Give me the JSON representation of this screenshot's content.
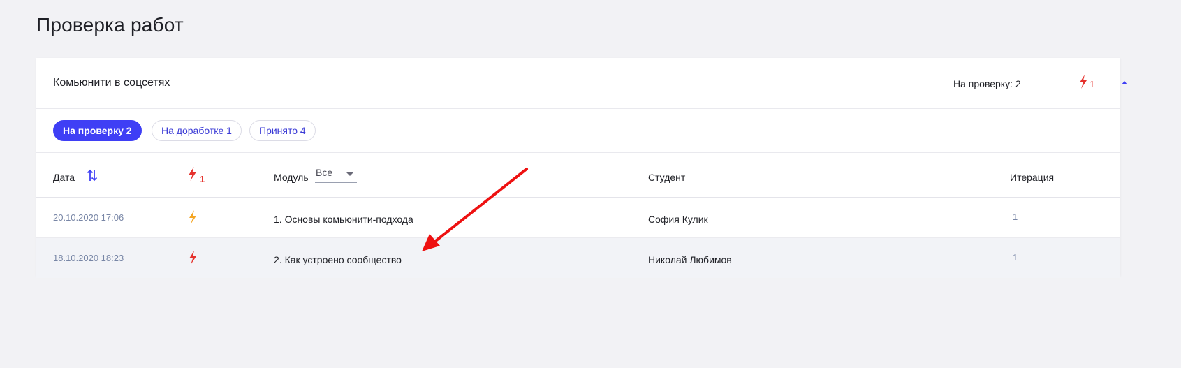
{
  "page": {
    "title": "Проверка работ"
  },
  "course": {
    "title": "Комьюнити в соцсетях",
    "review_count": "На проверку: 2",
    "urgent_count": "1",
    "collapse_icon": "triangle-up-icon"
  },
  "tabs": [
    {
      "label": "На проверку 2",
      "active": true
    },
    {
      "label": "На доработке 1",
      "active": false
    },
    {
      "label": "Принято 4",
      "active": false
    }
  ],
  "table": {
    "headers": {
      "date": "Дата",
      "urgent_count": "1",
      "module": "Модуль",
      "module_filter": "Все",
      "student": "Студент",
      "iteration": "Итерация"
    },
    "rows": [
      {
        "date": "20.10.2020 17:06",
        "bolt_color": "#f5a623",
        "module": "1. Основы комьюнити-подхода",
        "student": "София Кулик",
        "iteration": "1"
      },
      {
        "date": "18.10.2020 18:23",
        "bolt_color": "#e5322d",
        "module": "2. Как устроено сообщество",
        "student": "Николай Любимов",
        "iteration": "1"
      }
    ]
  },
  "colors": {
    "accent": "#3f3ff5",
    "urgent": "#e5322d",
    "warning": "#f5a623",
    "annotation_arrow": "#ee1111"
  }
}
